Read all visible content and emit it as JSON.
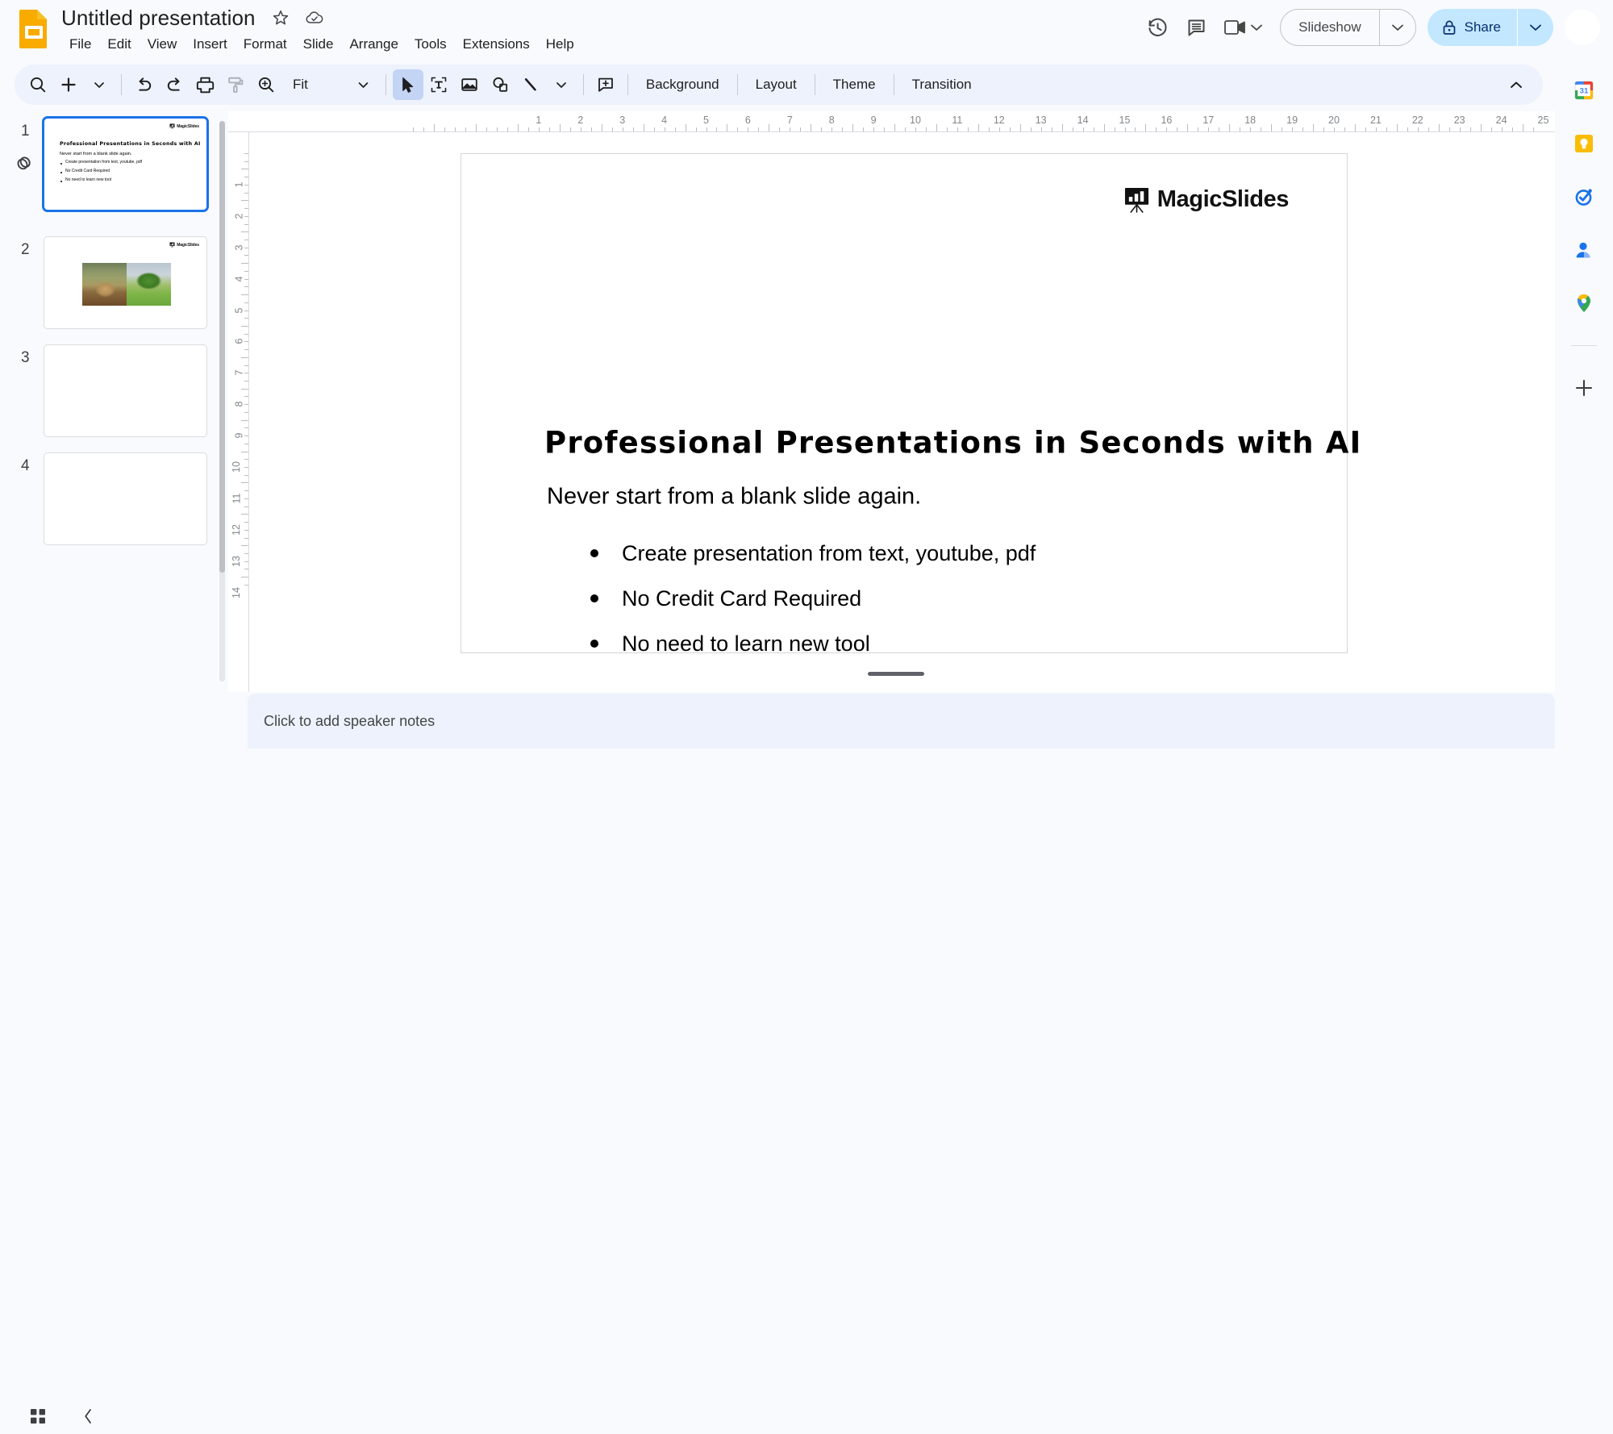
{
  "app": {
    "name": "Google Slides",
    "logo_icon": "slides-logo-icon"
  },
  "header": {
    "doc_title": "Untitled presentation",
    "star_icon": "star-icon",
    "cloud_icon": "cloud-saved-icon",
    "menus": [
      "File",
      "Edit",
      "View",
      "Insert",
      "Format",
      "Slide",
      "Arrange",
      "Tools",
      "Extensions",
      "Help"
    ],
    "history_icon": "version-history-icon",
    "comment_icon": "comment-icon",
    "meet_icon": "meet-camera-icon",
    "meet_caret": "chevron-down-icon",
    "slideshow_label": "Slideshow",
    "slideshow_caret": "chevron-down-icon",
    "share_label": "Share",
    "share_lock_icon": "lock-icon",
    "share_caret": "chevron-down-icon",
    "avatar": "user-avatar"
  },
  "toolbar": {
    "search_icon": "search-icon",
    "new_slide_icon": "plus-icon",
    "new_slide_caret": "chevron-down-icon",
    "undo_icon": "undo-icon",
    "redo_icon": "redo-icon",
    "print_icon": "print-icon",
    "paint_format_icon": "paint-format-icon",
    "zoom_icon": "zoom-icon",
    "zoom_value": "Fit",
    "zoom_caret": "chevron-down-icon",
    "select_icon": "select-cursor-icon",
    "textbox_icon": "text-box-icon",
    "image_icon": "insert-image-icon",
    "shape_icon": "shape-icon",
    "line_icon": "line-icon",
    "line_caret": "chevron-down-icon",
    "comment_add_icon": "add-comment-icon",
    "background_label": "Background",
    "layout_label": "Layout",
    "theme_label": "Theme",
    "transition_label": "Transition",
    "collapse_icon": "chevron-up-icon"
  },
  "filmstrip": {
    "slides": [
      {
        "number": "1",
        "selected": true,
        "has_link_badge": true,
        "link_icon": "link-chain-icon",
        "logo_text": "MagicSlides",
        "title": "Professional Presentations in Seconds with AI",
        "subtitle": "Never start from a blank slide again.",
        "bullets": [
          "Create presentation from text, youtube, pdf",
          "No Credit Card Required",
          "No need to learn new tool"
        ]
      },
      {
        "number": "2",
        "selected": false,
        "has_link_badge": false,
        "logo_text": "MagicSlides",
        "images": [
          "cheetah-photo",
          "tree-photo"
        ]
      },
      {
        "number": "3",
        "selected": false,
        "has_link_badge": false
      },
      {
        "number": "4",
        "selected": false,
        "has_link_badge": false
      }
    ]
  },
  "rulers": {
    "horizontal_ticks": [
      "1",
      "2",
      "3",
      "4",
      "5",
      "6",
      "7",
      "8",
      "9",
      "10",
      "11",
      "12",
      "13",
      "14",
      "15",
      "16",
      "17",
      "18",
      "19",
      "20",
      "21",
      "22",
      "23",
      "24",
      "25"
    ],
    "vertical_ticks": [
      "1",
      "2",
      "3",
      "4",
      "5",
      "6",
      "7",
      "8",
      "9",
      "10",
      "11",
      "12",
      "13",
      "14"
    ],
    "unit": "inches"
  },
  "slide": {
    "logo_text": "MagicSlides",
    "logo_icon": "magicslides-easel-icon",
    "title": "Professional Presentations in Seconds with AI",
    "subtitle": "Never start from a blank slide again.",
    "bullets": [
      "Create presentation from text, youtube, pdf",
      "No Credit Card Required",
      "No need to learn new tool"
    ]
  },
  "notes": {
    "placeholder": "Click to add speaker notes"
  },
  "bottom_bar": {
    "grid_view_icon": "grid-view-icon",
    "collapse_filmstrip_icon": "chevron-left-icon",
    "expand_panel_icon": "chevron-right-icon"
  },
  "side_panel": {
    "items": [
      {
        "name": "calendar-icon",
        "label": "31"
      },
      {
        "name": "keep-icon",
        "label": ""
      },
      {
        "name": "tasks-icon",
        "label": ""
      },
      {
        "name": "contacts-icon",
        "label": ""
      },
      {
        "name": "maps-icon",
        "label": ""
      }
    ],
    "add_icon": "plus-icon"
  },
  "colors": {
    "accent_blue": "#1a73e8",
    "share_bg": "#c2e7ff",
    "toolbar_bg": "#edf2fc",
    "app_bg": "#f8fafd",
    "slides_yellow": "#f9ab00"
  }
}
